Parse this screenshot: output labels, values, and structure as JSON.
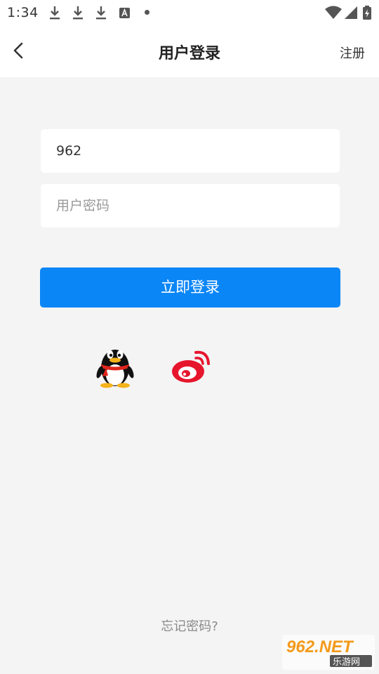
{
  "status_bar": {
    "time": "1:34",
    "icons": [
      "download-icon",
      "download-icon",
      "download-icon",
      "font-icon",
      "dot-icon",
      "wifi-icon",
      "signal-icon",
      "battery-charging-icon"
    ]
  },
  "header": {
    "back_icon": "chevron-left-icon",
    "title": "用户登录",
    "register_label": "注册"
  },
  "form": {
    "username_value": "962",
    "password_placeholder": "用户密码",
    "login_label": "立即登录"
  },
  "social": [
    "qq-icon",
    "weibo-icon"
  ],
  "forgot_password": "忘记密码?",
  "colors": {
    "accent": "#0a86f7",
    "background": "#f4f4f4",
    "weibo": "#e6162d"
  },
  "watermark": {
    "brand": "962.NET",
    "subtitle": "乐游网"
  }
}
